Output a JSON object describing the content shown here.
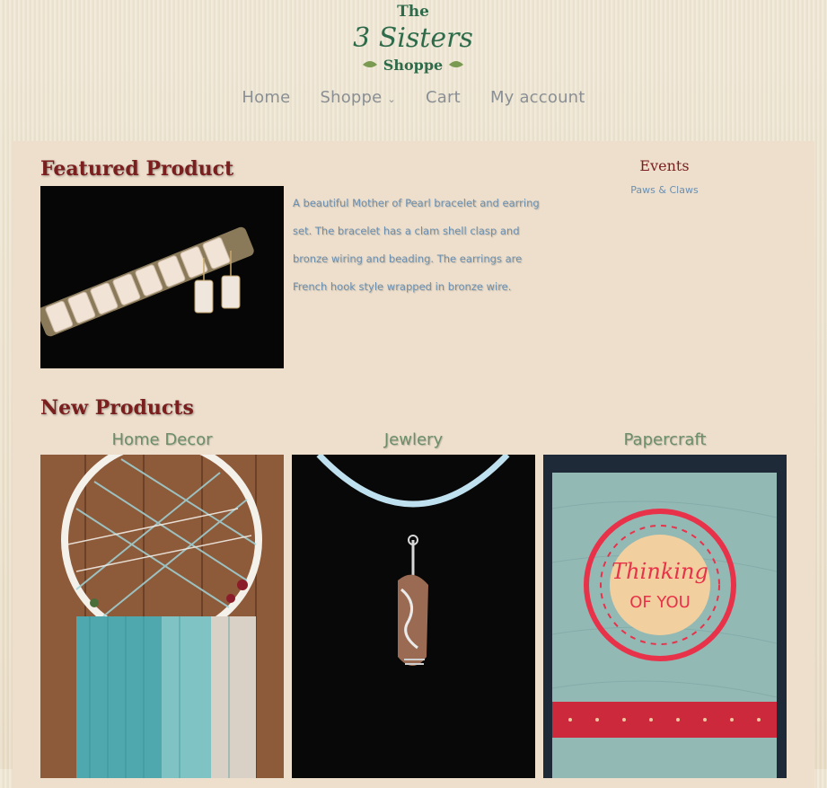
{
  "site": {
    "logo_text": "The 3 Sisters Shoppe",
    "logo_top": "The",
    "logo_mid": "3 Sisters",
    "logo_bottom": "Shoppe"
  },
  "nav": {
    "items": [
      {
        "label": "Home"
      },
      {
        "label": "Shoppe"
      },
      {
        "label": "Cart"
      },
      {
        "label": "My account"
      }
    ]
  },
  "featured": {
    "title": "Featured Product",
    "description": "A beautiful Mother of Pearl bracelet and earring set. The bracelet has a clam shell clasp and bronze wiring and beading. The earrings are French hook style wrapped in bronze wire."
  },
  "events": {
    "title": "Events",
    "items": [
      {
        "label": "Paws & Claws"
      }
    ]
  },
  "new_products": {
    "title": "New Products",
    "items": [
      {
        "label": "Home Decor"
      },
      {
        "label": "Jewlery"
      },
      {
        "label": "Papercraft"
      }
    ]
  },
  "card": {
    "line1": "Thinking",
    "line2": "OF YOU"
  },
  "colors": {
    "title_red": "#7a1e1e",
    "nav_gray": "#8a8f94",
    "link_blue": "#6b8fb0",
    "label_green": "#6c8f6a",
    "panel_bg": "#eddfcc"
  }
}
